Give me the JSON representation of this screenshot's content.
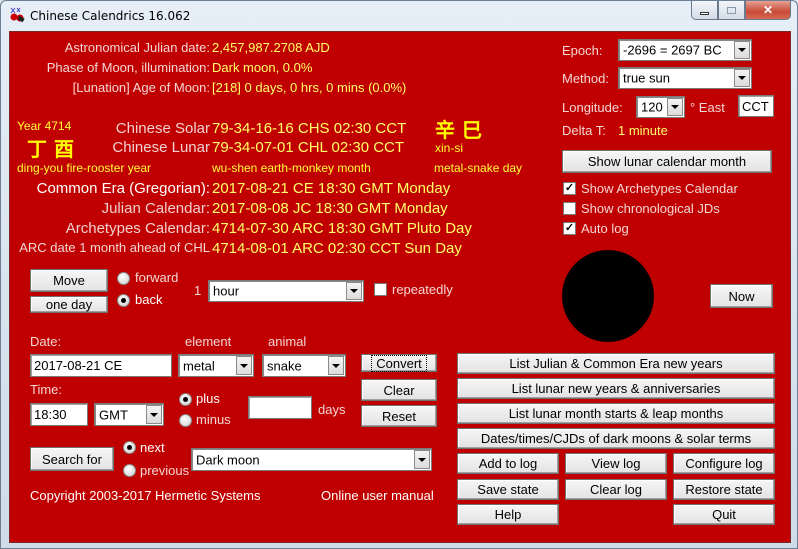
{
  "window": {
    "title": "Chinese Calendrics 16.062",
    "app_icon": "firecracker-icon",
    "controls": {
      "minimize": "minimize-icon",
      "maximize": "maximize-icon",
      "close": "close-icon"
    }
  },
  "astro": {
    "ajd_label": "Astronomical Julian date:",
    "ajd_value": "2,457,987.2708 AJD",
    "phase_label": "Phase of Moon, illumination:",
    "phase_value": "Dark moon, 0.0%",
    "age_label": "[Lunation] Age of Moon:",
    "age_value": "[218] 0 days, 0 hrs, 0 mins (0.0%)"
  },
  "chinese": {
    "year_label": "Year 4714",
    "year_chars": "丁 酉",
    "year_desc": "ding-you fire-rooster year",
    "solar_label": "Chinese Solar",
    "solar_value": "79-34-16-16 CHS 02:30 CCT",
    "lunar_label": "Chinese Lunar",
    "lunar_value": "79-34-07-01 CHL 02:30 CCT",
    "day_chars": "辛 巳",
    "day_pinyin": "xin-si",
    "month_desc": "wu-shen earth-monkey month",
    "day_desc": "metal-snake day"
  },
  "calendars": {
    "ce_label": "Common Era (Gregorian):",
    "ce_value": "2017-08-21 CE 18:30 GMT Monday",
    "jc_label": "Julian Calendar:",
    "jc_value": "2017-08-08 JC 18:30 GMT Monday",
    "arc_label": "Archetypes Calendar:",
    "arc_value": "4714-07-30 ARC 18:30 GMT Pluto Day",
    "arc_ahead_label": "ARC date 1 month ahead of CHL",
    "arc_ahead_value": "4714-08-01 ARC 02:30 CCT Sun Day"
  },
  "settings": {
    "epoch_label": "Epoch:",
    "epoch_value": "-2696 = 2697 BC",
    "method_label": "Method:",
    "method_value": "true sun",
    "longitude_label": "Longitude:",
    "longitude_value": "120",
    "east_label": "° East",
    "timezone_value": "CCT",
    "delta_t_label": "Delta T:",
    "delta_t_value": "1 minute",
    "show_lunar_month_btn": "Show lunar calendar month",
    "checks": [
      {
        "label": "Show Archetypes Calendar",
        "checked": true
      },
      {
        "label": "Show chronological JDs",
        "checked": false
      },
      {
        "label": "Auto log",
        "checked": true
      }
    ],
    "now_btn": "Now"
  },
  "move": {
    "move_btn": "Move",
    "unit_btn": "one day",
    "forward_label": "forward",
    "back_label": "back",
    "direction": "back",
    "count": "1",
    "unit_value": "hour",
    "repeatedly_label": "repeatedly",
    "repeatedly_checked": false
  },
  "convert": {
    "date_label": "Date:",
    "date_value": "2017-08-21 CE",
    "element_label": "element",
    "element_value": "metal",
    "animal_label": "animal",
    "animal_value": "snake",
    "convert_btn": "Convert",
    "clear_btn": "Clear",
    "reset_btn": "Reset",
    "time_label": "Time:",
    "time_value": "18:30",
    "tz_value": "GMT",
    "plus_label": "plus",
    "minus_label": "minus",
    "sign": "plus",
    "days_value": "",
    "days_label": "days"
  },
  "search": {
    "search_btn": "Search for",
    "next_label": "next",
    "previous_label": "previous",
    "direction": "next",
    "target_value": "Dark moon"
  },
  "footer": {
    "copyright": "Copyright 2003-2017 Hermetic Systems",
    "manual_link": "Online user manual"
  },
  "actions": {
    "list_julian": "List Julian & Common Era new years",
    "list_lunar_new_years": "List lunar new years & anniversaries",
    "list_lunar_months": "List lunar month starts & leap months",
    "dark_moons": "Dates/times/CJDs of dark moons & solar terms",
    "add_to_log": "Add to log",
    "view_log": "View log",
    "configure_log": "Configure log",
    "save_state": "Save state",
    "clear_log": "Clear log",
    "restore_state": "Restore state",
    "help": "Help",
    "quit": "Quit"
  },
  "moon_phase": {
    "illumination_percent": 0.0
  }
}
